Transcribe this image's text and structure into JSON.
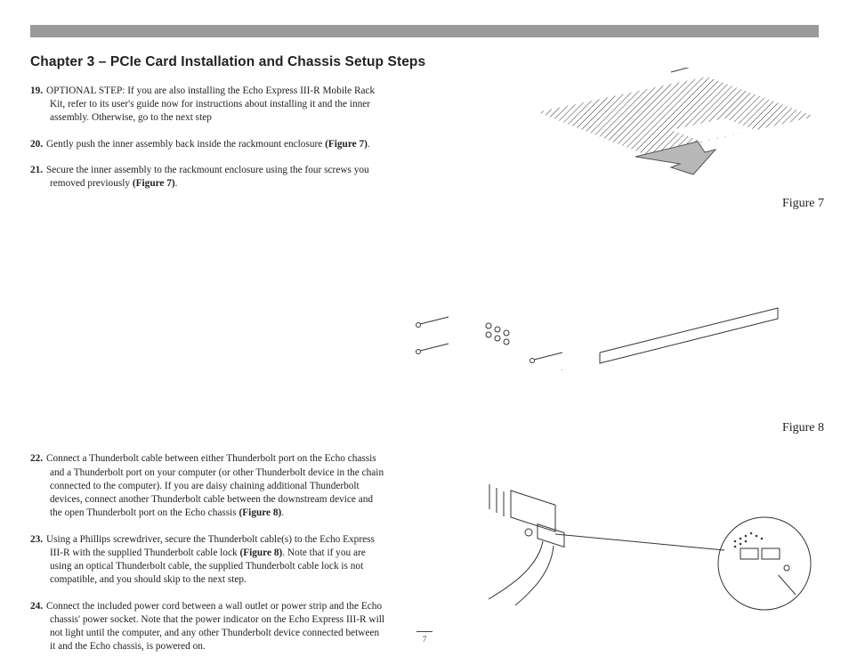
{
  "chapter_title": "Chapter 3 – PCIe Card Installation and Chassis Setup Steps",
  "steps_group1": [
    {
      "num": "19.",
      "text": "OPTIONAL STEP: If you are also installing the Echo Express III-R Mobile Rack Kit, refer to its user's guide now for instructions about installing it and the inner assembly. Otherwise, go to the next step"
    },
    {
      "num": "20.",
      "text_pre": "Gently push the inner assembly back inside the rackmount enclosure ",
      "bold": "(Figure 7)",
      "text_post": "."
    },
    {
      "num": "21.",
      "text_pre": "Secure the inner assembly to the rackmount enclosure using the four screws you removed previously ",
      "bold": "(Figure 7)",
      "text_post": "."
    }
  ],
  "steps_group2": [
    {
      "num": "22.",
      "text_pre": "Connect a Thunderbolt cable between either Thunderbolt port on the Echo chassis and a Thunderbolt port on your computer (or other Thunderbolt device in the chain connected to the computer). If you are daisy chaining additional Thunderbolt devices, connect another Thunderbolt cable between the downstream device and the open Thunderbolt port on the Echo chassis ",
      "bold": "(Figure 8)",
      "text_post": "."
    },
    {
      "num": "23.",
      "text_pre": "Using a Phillips screwdriver, secure the Thunderbolt cable(s) to the Echo Express III-R with the supplied Thunderbolt cable lock ",
      "bold": "(Figure 8)",
      "text_post": ". Note that if you are using an optical Thunderbolt cable, the supplied Thunderbolt cable lock is not compatible, and you should skip to the next step."
    },
    {
      "num": "24.",
      "text": "Connect the included power cord between a wall outlet or power strip and the Echo chassis' power socket. Note that the power indicator on the Echo Express III-R will not light until the computer, and any other Thunderbolt device connected between it and the Echo chassis, is powered on."
    }
  ],
  "figure7_label": "Figure 7",
  "figure8_label": "Figure 8",
  "page_number": "7"
}
